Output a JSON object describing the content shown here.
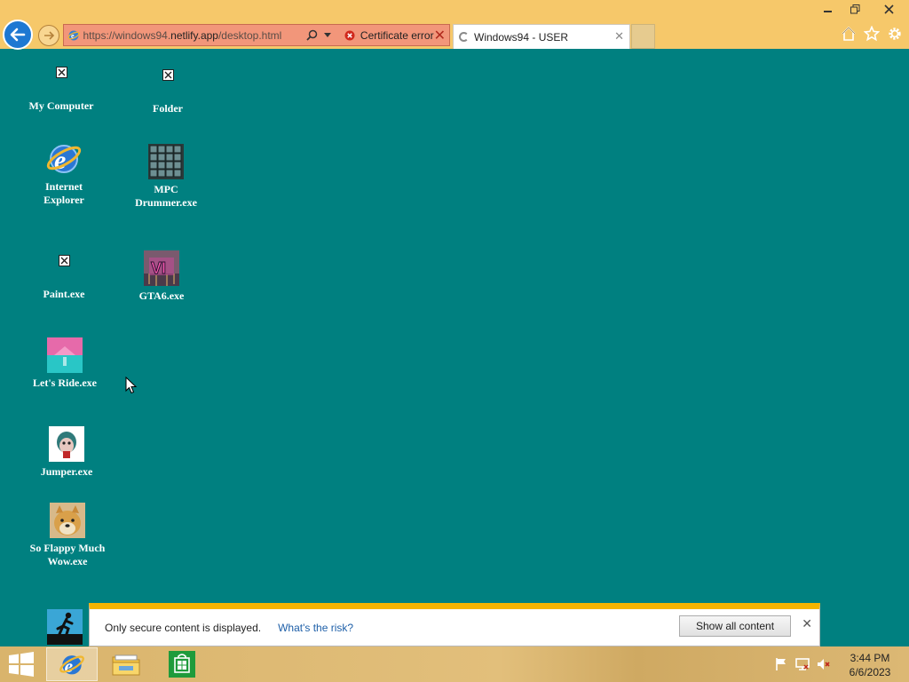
{
  "browser": {
    "url_faded": "https://windows94.",
    "url_domain": "netlify.app",
    "url_path": "/desktop.html",
    "cert_error": "Certificate error",
    "tab_title": "Windows94 - USER"
  },
  "desktop": {
    "icons": [
      {
        "label": "My Computer"
      },
      {
        "label": "Folder"
      },
      {
        "label": "Internet Explorer"
      },
      {
        "label": "MPC Drummer.exe"
      },
      {
        "label": "Paint.exe"
      },
      {
        "label": "GTA6.exe"
      },
      {
        "label": "Let's Ride.exe"
      },
      {
        "label": "Jumper.exe"
      },
      {
        "label": "So Flappy Much Wow.exe"
      }
    ],
    "gta_badge": "VI"
  },
  "infobar": {
    "message": "Only secure content is displayed.",
    "risk_link": "What's the risk?",
    "show_button": "Show all content"
  },
  "taskbar": {
    "time": "3:44 PM",
    "date": "6/6/2023"
  },
  "colors": {
    "desktop": "#008080",
    "chrome": "#f6c86a",
    "infobar_accent": "#f5b400"
  }
}
